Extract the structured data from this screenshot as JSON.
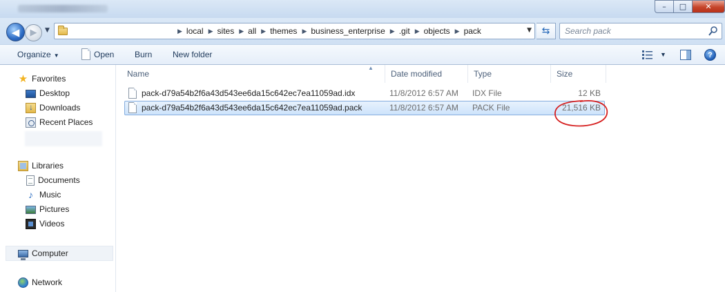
{
  "window": {
    "controls": {
      "minimize": "–",
      "maximize": "□",
      "close": "✕"
    }
  },
  "address": {
    "breadcrumbs": [
      "local",
      "sites",
      "all",
      "themes",
      "business_enterprise",
      ".git",
      "objects",
      "pack"
    ]
  },
  "search": {
    "placeholder": "Search pack"
  },
  "toolbar": {
    "organize": "Organize",
    "open": "Open",
    "burn": "Burn",
    "new_folder": "New folder"
  },
  "nav": {
    "favorites": "Favorites",
    "desktop": "Desktop",
    "downloads": "Downloads",
    "recent_places": "Recent Places",
    "libraries": "Libraries",
    "documents": "Documents",
    "music": "Music",
    "pictures": "Pictures",
    "videos": "Videos",
    "computer": "Computer",
    "network": "Network"
  },
  "columns": {
    "name": "Name",
    "date_modified": "Date modified",
    "type": "Type",
    "size": "Size"
  },
  "files": [
    {
      "name": "pack-d79a54b2f6a43d543ee6da15c642ec7ea11059ad.idx",
      "date": "11/8/2012 6:57 AM",
      "type": "IDX File",
      "size": "12 KB"
    },
    {
      "name": "pack-d79a54b2f6a43d543ee6da15c642ec7ea11059ad.pack",
      "date": "11/8/2012 6:57 AM",
      "type": "PACK File",
      "size": "21,516 KB"
    }
  ],
  "colors": {
    "annotation": "#d61f1f",
    "selection": "#cde3fb"
  },
  "icons": {
    "back": "back-arrow-icon",
    "forward": "forward-arrow-icon",
    "refresh": "refresh-icon",
    "search": "search-icon",
    "help": "help-icon"
  }
}
